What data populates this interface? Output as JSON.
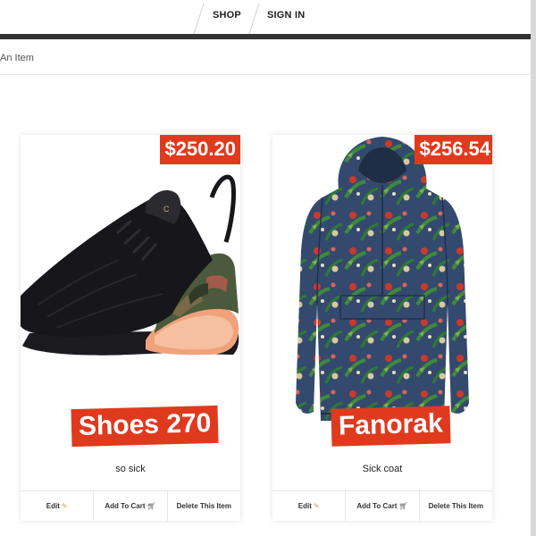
{
  "nav": {
    "shop": "SHOP",
    "sign_in": "SIGN IN"
  },
  "breadcrumb": "An Item",
  "products": [
    {
      "price": "$250.20",
      "title": "Shoes 270",
      "description": "so sick",
      "actions": {
        "edit": "Edit",
        "add_to_cart": "Add To Cart",
        "delete": "Delete This Item"
      }
    },
    {
      "price": "$256.54",
      "title": "Fanorak",
      "description": "Sick coat",
      "actions": {
        "edit": "Edit",
        "add_to_cart": "Add To Cart",
        "delete": "Delete This Item"
      }
    }
  ],
  "icons": {
    "edit": "pencil-icon",
    "cart": "cart-icon"
  },
  "colors": {
    "accent": "#e03a1e",
    "nav_bar": "#333333"
  }
}
